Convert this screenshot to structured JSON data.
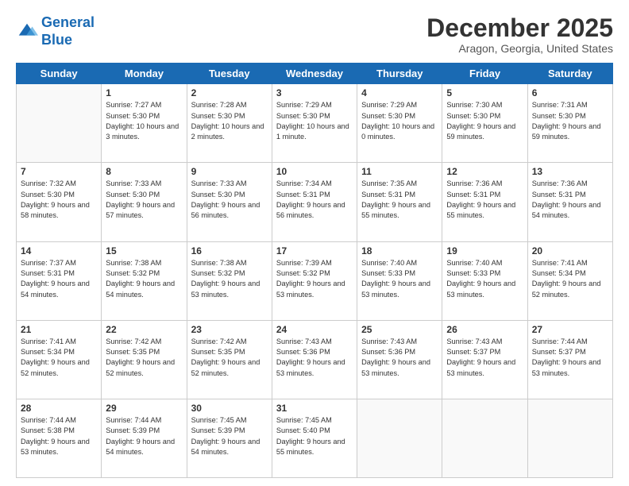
{
  "logo": {
    "line1": "General",
    "line2": "Blue"
  },
  "header": {
    "month": "December 2025",
    "location": "Aragon, Georgia, United States"
  },
  "weekdays": [
    "Sunday",
    "Monday",
    "Tuesday",
    "Wednesday",
    "Thursday",
    "Friday",
    "Saturday"
  ],
  "weeks": [
    [
      {
        "day": "",
        "sunrise": "",
        "sunset": "",
        "daylight": ""
      },
      {
        "day": "1",
        "sunrise": "Sunrise: 7:27 AM",
        "sunset": "Sunset: 5:30 PM",
        "daylight": "Daylight: 10 hours and 3 minutes."
      },
      {
        "day": "2",
        "sunrise": "Sunrise: 7:28 AM",
        "sunset": "Sunset: 5:30 PM",
        "daylight": "Daylight: 10 hours and 2 minutes."
      },
      {
        "day": "3",
        "sunrise": "Sunrise: 7:29 AM",
        "sunset": "Sunset: 5:30 PM",
        "daylight": "Daylight: 10 hours and 1 minute."
      },
      {
        "day": "4",
        "sunrise": "Sunrise: 7:29 AM",
        "sunset": "Sunset: 5:30 PM",
        "daylight": "Daylight: 10 hours and 0 minutes."
      },
      {
        "day": "5",
        "sunrise": "Sunrise: 7:30 AM",
        "sunset": "Sunset: 5:30 PM",
        "daylight": "Daylight: 9 hours and 59 minutes."
      },
      {
        "day": "6",
        "sunrise": "Sunrise: 7:31 AM",
        "sunset": "Sunset: 5:30 PM",
        "daylight": "Daylight: 9 hours and 59 minutes."
      }
    ],
    [
      {
        "day": "7",
        "sunrise": "Sunrise: 7:32 AM",
        "sunset": "Sunset: 5:30 PM",
        "daylight": "Daylight: 9 hours and 58 minutes."
      },
      {
        "day": "8",
        "sunrise": "Sunrise: 7:33 AM",
        "sunset": "Sunset: 5:30 PM",
        "daylight": "Daylight: 9 hours and 57 minutes."
      },
      {
        "day": "9",
        "sunrise": "Sunrise: 7:33 AM",
        "sunset": "Sunset: 5:30 PM",
        "daylight": "Daylight: 9 hours and 56 minutes."
      },
      {
        "day": "10",
        "sunrise": "Sunrise: 7:34 AM",
        "sunset": "Sunset: 5:31 PM",
        "daylight": "Daylight: 9 hours and 56 minutes."
      },
      {
        "day": "11",
        "sunrise": "Sunrise: 7:35 AM",
        "sunset": "Sunset: 5:31 PM",
        "daylight": "Daylight: 9 hours and 55 minutes."
      },
      {
        "day": "12",
        "sunrise": "Sunrise: 7:36 AM",
        "sunset": "Sunset: 5:31 PM",
        "daylight": "Daylight: 9 hours and 55 minutes."
      },
      {
        "day": "13",
        "sunrise": "Sunrise: 7:36 AM",
        "sunset": "Sunset: 5:31 PM",
        "daylight": "Daylight: 9 hours and 54 minutes."
      }
    ],
    [
      {
        "day": "14",
        "sunrise": "Sunrise: 7:37 AM",
        "sunset": "Sunset: 5:31 PM",
        "daylight": "Daylight: 9 hours and 54 minutes."
      },
      {
        "day": "15",
        "sunrise": "Sunrise: 7:38 AM",
        "sunset": "Sunset: 5:32 PM",
        "daylight": "Daylight: 9 hours and 54 minutes."
      },
      {
        "day": "16",
        "sunrise": "Sunrise: 7:38 AM",
        "sunset": "Sunset: 5:32 PM",
        "daylight": "Daylight: 9 hours and 53 minutes."
      },
      {
        "day": "17",
        "sunrise": "Sunrise: 7:39 AM",
        "sunset": "Sunset: 5:32 PM",
        "daylight": "Daylight: 9 hours and 53 minutes."
      },
      {
        "day": "18",
        "sunrise": "Sunrise: 7:40 AM",
        "sunset": "Sunset: 5:33 PM",
        "daylight": "Daylight: 9 hours and 53 minutes."
      },
      {
        "day": "19",
        "sunrise": "Sunrise: 7:40 AM",
        "sunset": "Sunset: 5:33 PM",
        "daylight": "Daylight: 9 hours and 53 minutes."
      },
      {
        "day": "20",
        "sunrise": "Sunrise: 7:41 AM",
        "sunset": "Sunset: 5:34 PM",
        "daylight": "Daylight: 9 hours and 52 minutes."
      }
    ],
    [
      {
        "day": "21",
        "sunrise": "Sunrise: 7:41 AM",
        "sunset": "Sunset: 5:34 PM",
        "daylight": "Daylight: 9 hours and 52 minutes."
      },
      {
        "day": "22",
        "sunrise": "Sunrise: 7:42 AM",
        "sunset": "Sunset: 5:35 PM",
        "daylight": "Daylight: 9 hours and 52 minutes."
      },
      {
        "day": "23",
        "sunrise": "Sunrise: 7:42 AM",
        "sunset": "Sunset: 5:35 PM",
        "daylight": "Daylight: 9 hours and 52 minutes."
      },
      {
        "day": "24",
        "sunrise": "Sunrise: 7:43 AM",
        "sunset": "Sunset: 5:36 PM",
        "daylight": "Daylight: 9 hours and 53 minutes."
      },
      {
        "day": "25",
        "sunrise": "Sunrise: 7:43 AM",
        "sunset": "Sunset: 5:36 PM",
        "daylight": "Daylight: 9 hours and 53 minutes."
      },
      {
        "day": "26",
        "sunrise": "Sunrise: 7:43 AM",
        "sunset": "Sunset: 5:37 PM",
        "daylight": "Daylight: 9 hours and 53 minutes."
      },
      {
        "day": "27",
        "sunrise": "Sunrise: 7:44 AM",
        "sunset": "Sunset: 5:37 PM",
        "daylight": "Daylight: 9 hours and 53 minutes."
      }
    ],
    [
      {
        "day": "28",
        "sunrise": "Sunrise: 7:44 AM",
        "sunset": "Sunset: 5:38 PM",
        "daylight": "Daylight: 9 hours and 53 minutes."
      },
      {
        "day": "29",
        "sunrise": "Sunrise: 7:44 AM",
        "sunset": "Sunset: 5:39 PM",
        "daylight": "Daylight: 9 hours and 54 minutes."
      },
      {
        "day": "30",
        "sunrise": "Sunrise: 7:45 AM",
        "sunset": "Sunset: 5:39 PM",
        "daylight": "Daylight: 9 hours and 54 minutes."
      },
      {
        "day": "31",
        "sunrise": "Sunrise: 7:45 AM",
        "sunset": "Sunset: 5:40 PM",
        "daylight": "Daylight: 9 hours and 55 minutes."
      },
      {
        "day": "",
        "sunrise": "",
        "sunset": "",
        "daylight": ""
      },
      {
        "day": "",
        "sunrise": "",
        "sunset": "",
        "daylight": ""
      },
      {
        "day": "",
        "sunrise": "",
        "sunset": "",
        "daylight": ""
      }
    ]
  ]
}
